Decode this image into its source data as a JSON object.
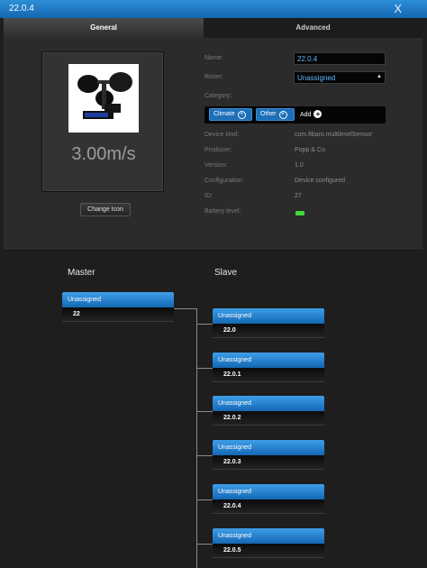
{
  "window": {
    "title": "22.0.4",
    "close_label": "X"
  },
  "tabs": [
    {
      "label": "General"
    },
    {
      "label": "Advanced"
    }
  ],
  "device": {
    "reading": "3.00m/s",
    "change_icon_label": "Change Icon",
    "icon": "anemometer-image"
  },
  "fields": {
    "name_label": "Name:",
    "name_value": "22.0.4",
    "room_label": "Room:",
    "room_value": "Unassigned",
    "category_label": "Category:",
    "categories": [
      {
        "label": "Climate"
      },
      {
        "label": "Other"
      }
    ],
    "add_label": "Add",
    "device_kind_label": "Device kind:",
    "device_kind_value": "com.fibaro.multilevelSensor",
    "producer_label": "Producer:",
    "producer_value": "Popp & Co",
    "version_label": "Version:",
    "version_value": "1.0",
    "configuration_label": "Configuration:",
    "configuration_value": "Device configured",
    "id_label": "ID:",
    "id_value": "27",
    "battery_label": "Battery level:"
  },
  "associations": {
    "master_title": "Master",
    "slave_title": "Slave",
    "master": {
      "room": "Unassigned",
      "name": "22"
    },
    "slaves": [
      {
        "room": "Unassigned",
        "name": "22.0"
      },
      {
        "room": "Unassigned",
        "name": "22.0.1"
      },
      {
        "room": "Unassigned",
        "name": "22.0.2"
      },
      {
        "room": "Unassigned",
        "name": "22.0.3"
      },
      {
        "room": "Unassigned",
        "name": "22.0.4"
      },
      {
        "room": "Unassigned",
        "name": "22.0.5"
      }
    ]
  },
  "colors": {
    "accent": "#1d6fb8",
    "titlebar": "#2d8fd8",
    "battery": "#42d83a"
  }
}
